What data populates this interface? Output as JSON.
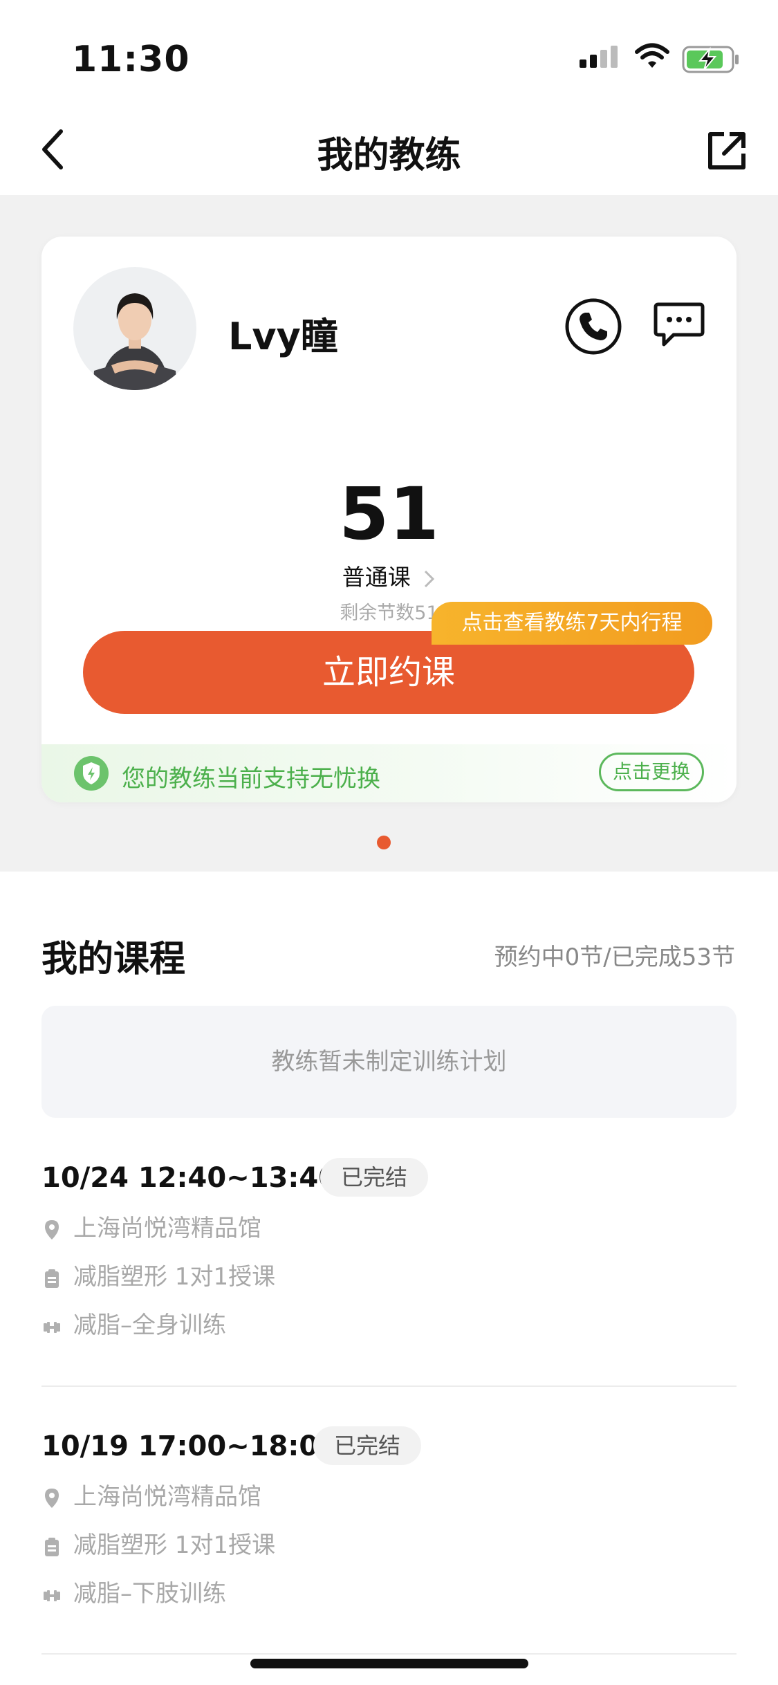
{
  "status_bar": {
    "time": "11:30"
  },
  "nav": {
    "title": "我的教练"
  },
  "coach": {
    "name": "Lvy瞳",
    "remaining_count": "51",
    "course_type": "普通课",
    "remaining_text": "剩余节数51",
    "schedule_tag": "点击查看教练7天内行程",
    "book_button": "立即约课",
    "guarantee_text": "您的教练当前支持无忧换",
    "switch_button": "点击更换"
  },
  "courses": {
    "title": "我的课程",
    "summary": "预约中0节/已完成53节",
    "plan_empty": "教练暂未制定训练计划",
    "lessons": [
      {
        "time": "10/24 12:40~13:40",
        "status": "已完结",
        "location": "上海尚悦湾精品馆",
        "type": "减脂塑形 1对1授课",
        "plan": "减脂–全身训练"
      },
      {
        "time": "10/19 17:00~18:00",
        "status": "已完结",
        "location": "上海尚悦湾精品馆",
        "type": "减脂塑形 1对1授课",
        "plan": "减脂–下肢训练"
      }
    ]
  },
  "colors": {
    "accent": "#e85a30",
    "tag": "#f4a625",
    "green": "#4cb04c"
  },
  "icons": [
    "back-arrow-icon",
    "share-icon",
    "phone-icon",
    "message-icon",
    "chevron-right-icon",
    "shield-icon",
    "location-pin-icon",
    "clipboard-icon",
    "dumbbell-icon"
  ]
}
